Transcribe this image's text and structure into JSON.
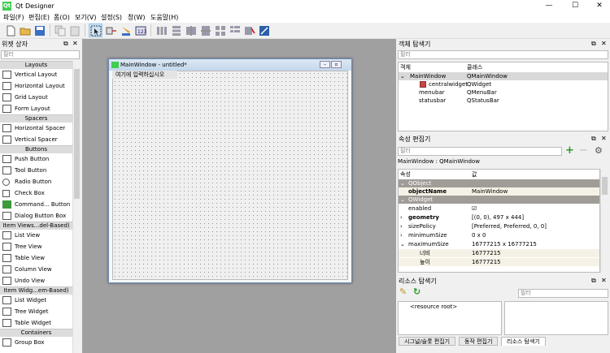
{
  "window": {
    "title": "Qt Designer",
    "icon": "qt-logo-icon"
  },
  "menu": [
    "파일(F)",
    "편집(E)",
    "폼(O)",
    "보기(V)",
    "설정(S)",
    "창(W)",
    "도움말(H)"
  ],
  "widget_box": {
    "title": "위젯 상자",
    "filter_placeholder": "필터",
    "categories": {
      "layouts": "Layouts",
      "spacers": "Spacers",
      "buttons": "Buttons",
      "item_views": "Item Views...del-Based)",
      "item_widgets": "Item Widg...em-Based)",
      "containers": "Containers"
    },
    "layouts": [
      "Vertical Layout",
      "Horizontal Layout",
      "Grid Layout",
      "Form Layout"
    ],
    "spacers": [
      "Horizontal Spacer",
      "Vertical Spacer"
    ],
    "buttons": [
      "Push Button",
      "Tool Button",
      "Radio Button",
      "Check Box",
      "Command... Button",
      "Dialog Button Box"
    ],
    "item_views": [
      "List View",
      "Tree View",
      "Table View",
      "Column View",
      "Undo View"
    ],
    "item_widgets": [
      "List Widget",
      "Tree Widget",
      "Table Widget"
    ],
    "containers": [
      "Group Box"
    ]
  },
  "form": {
    "title": "MainWindow - untitled*",
    "hint": "여기에 입력하십시오"
  },
  "object_inspector": {
    "title": "객체 탐색기",
    "filter_placeholder": "필터",
    "col_object": "객체",
    "col_class": "클래스",
    "rows": [
      {
        "object": "MainWindow",
        "class": "QMainWindow"
      },
      {
        "object": "centralwidget",
        "class": "QWidget"
      },
      {
        "object": "menubar",
        "class": "QMenuBar"
      },
      {
        "object": "statusbar",
        "class": "QStatusBar"
      }
    ]
  },
  "property_editor": {
    "title": "속성 편집기",
    "filter_placeholder": "필터",
    "context": "MainWindow : QMainWindow",
    "col_property": "속성",
    "col_value": "값",
    "rows": [
      {
        "name": "QObject",
        "value": ""
      },
      {
        "name": "objectName",
        "value": "MainWindow"
      },
      {
        "name": "QWidget",
        "value": ""
      },
      {
        "name": "enabled",
        "value": "☑"
      },
      {
        "name": "geometry",
        "value": "[(0, 0), 497 x 444]"
      },
      {
        "name": "sizePolicy",
        "value": "[Preferred, Preferred, 0, 0]"
      },
      {
        "name": "minimumSize",
        "value": "0 x 0"
      },
      {
        "name": "maximumSize",
        "value": "16777215 x 16777215"
      },
      {
        "name": "너비",
        "value": "16777215"
      },
      {
        "name": "높이",
        "value": "16777215"
      }
    ]
  },
  "resource_browser": {
    "title": "리소스 탐색기",
    "filter_placeholder": "필터",
    "root": "<resource root>"
  },
  "bottom_tabs": [
    "시그널/슬롯 편집기",
    "동작 편집기",
    "리소스 탐색기"
  ],
  "colors": {
    "category_bg": "#dcdcdc",
    "group_bg": "#a09c98",
    "qt_green": "#41cd52",
    "accent": "#cce4f7"
  }
}
